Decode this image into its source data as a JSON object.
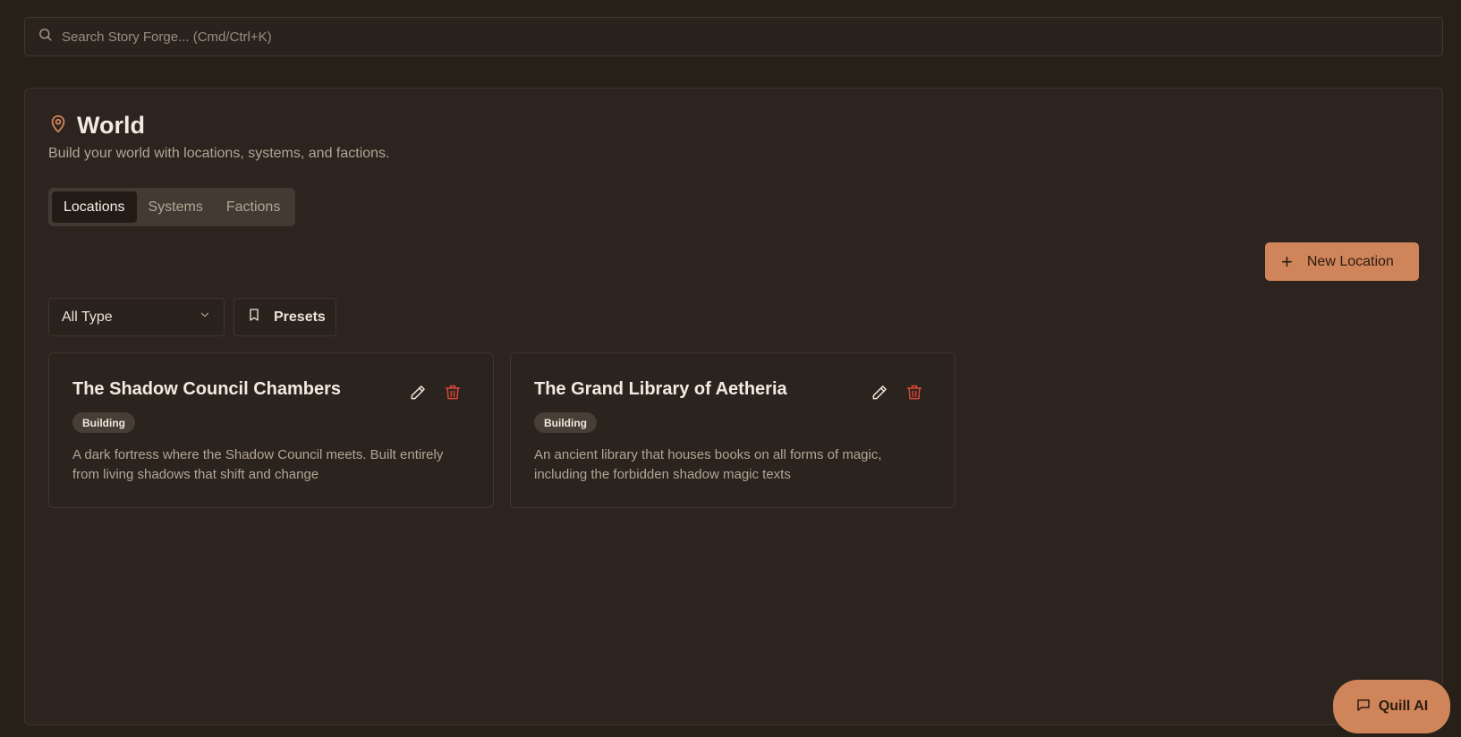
{
  "search": {
    "placeholder": "Search Story Forge... (Cmd/Ctrl+K)"
  },
  "header": {
    "title": "World",
    "subtitle": "Build your world with locations, systems, and factions."
  },
  "tabs": [
    {
      "label": "Locations",
      "active": true
    },
    {
      "label": "Systems",
      "active": false
    },
    {
      "label": "Factions",
      "active": false
    }
  ],
  "actions": {
    "new_location_label": "New Location"
  },
  "filters": {
    "type_selected": "All Type",
    "presets_label": "Presets"
  },
  "cards": [
    {
      "title": "The Shadow Council Chambers",
      "badge": "Building",
      "description": "A dark fortress where the Shadow Council meets. Built entirely from living shadows that shift and change"
    },
    {
      "title": "The Grand Library of Aetheria",
      "badge": "Building",
      "description": "An ancient library that houses books on all forms of magic, including the forbidden shadow magic texts"
    }
  ],
  "assistant": {
    "label": "Quill AI"
  },
  "colors": {
    "accent": "#cf8559",
    "danger": "#d9473d",
    "background": "#272019",
    "panel": "#2d241f"
  }
}
